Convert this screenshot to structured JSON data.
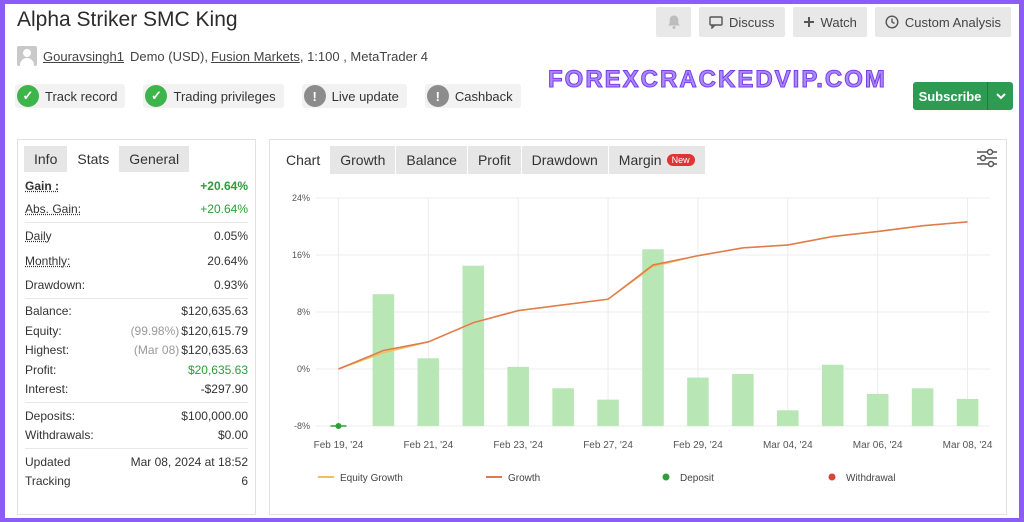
{
  "header": {
    "title": "Alpha Striker SMC King",
    "buttons": {
      "discuss": "Discuss",
      "watch": "Watch",
      "custom": "Custom Analysis"
    },
    "user": "Gouravsingh1",
    "account_type": "Demo (USD),",
    "broker": "Fusion Markets",
    "details": ", 1:100 , MetaTrader 4"
  },
  "badges": [
    {
      "label": "Track record",
      "icon": "check-icon"
    },
    {
      "label": "Trading privileges",
      "icon": "check-icon"
    },
    {
      "label": "Live update",
      "icon": "info-icon"
    },
    {
      "label": "Cashback",
      "icon": "info-icon"
    }
  ],
  "watermark": "FOREXCRACKEDVIP.COM",
  "subscribe": "Subscribe",
  "left_tabs": [
    "Info",
    "Stats",
    "General"
  ],
  "stats": {
    "gain": {
      "label": "Gain :",
      "value": "+20.64%"
    },
    "abs_gain": {
      "label": "Abs. Gain:",
      "value": "+20.64%"
    },
    "daily": {
      "label": "Daily",
      "value": "0.05%"
    },
    "monthly": {
      "label": "Monthly:",
      "value": "20.64%"
    },
    "drawdown": {
      "label": "Drawdown:",
      "value": "0.93%"
    },
    "balance": {
      "label": "Balance:",
      "value": "$120,635.63"
    },
    "equity": {
      "label": "Equity:",
      "note": "(99.98%)",
      "value": "$120,615.79"
    },
    "highest": {
      "label": "Highest:",
      "note": "(Mar 08)",
      "value": "$120,635.63"
    },
    "profit": {
      "label": "Profit:",
      "value": "$20,635.63"
    },
    "interest": {
      "label": "Interest:",
      "value": "-$297.90"
    },
    "deposits": {
      "label": "Deposits:",
      "value": "$100,000.00"
    },
    "withdrawals": {
      "label": "Withdrawals:",
      "value": "$0.00"
    },
    "updated": {
      "label": "Updated",
      "value": "Mar 08, 2024 at 18:52"
    },
    "tracking": {
      "label": "Tracking",
      "value": "6"
    }
  },
  "chart_tabs": {
    "chart": "Chart",
    "growth": "Growth",
    "balance": "Balance",
    "profit": "Profit",
    "drawdown": "Drawdown",
    "margin": "Margin",
    "new": "New"
  },
  "colors": {
    "bar": "#b9e6b5",
    "growth": "#e07a4f",
    "equity": "#f0c05a",
    "deposit": "#2f9e3a",
    "withdrawal": "#d9443a",
    "accent_green": "#2e9b52"
  },
  "chart_data": {
    "type": "bar",
    "x_tick_labels": [
      "Feb 19, '24",
      "Feb 21, '24",
      "Feb 23, '24",
      "Feb 27, '24",
      "Feb 29, '24",
      "Mar 04, '24",
      "Mar 06, '24",
      "Mar 08, '24"
    ],
    "y_ticks": [
      "24%",
      "16%",
      "8%",
      "0%",
      "-8%"
    ],
    "ylim": [
      -8,
      24
    ],
    "bars": [
      -8,
      10.5,
      1.5,
      14.5,
      0.3,
      -2.7,
      -4.3,
      16.8,
      -1.2,
      -0.7,
      -5.8,
      0.6,
      -3.5,
      -2.7,
      -4.2
    ],
    "growth": [
      0,
      2.6,
      3.8,
      6.5,
      8.2,
      9,
      9.8,
      14.6,
      15.9,
      17,
      17.4,
      18.6,
      19.3,
      20.1,
      20.64
    ],
    "equity_growth": [
      0,
      2.3,
      3.8,
      6.5,
      8.2,
      9,
      9.8,
      14.4,
      15.9,
      17,
      17.4,
      18.6,
      19.3,
      20.1,
      20.64
    ],
    "deposit_point": {
      "index": 0,
      "value": -8
    },
    "legend": [
      "Equity Growth",
      "Growth",
      "Deposit",
      "Withdrawal"
    ]
  }
}
